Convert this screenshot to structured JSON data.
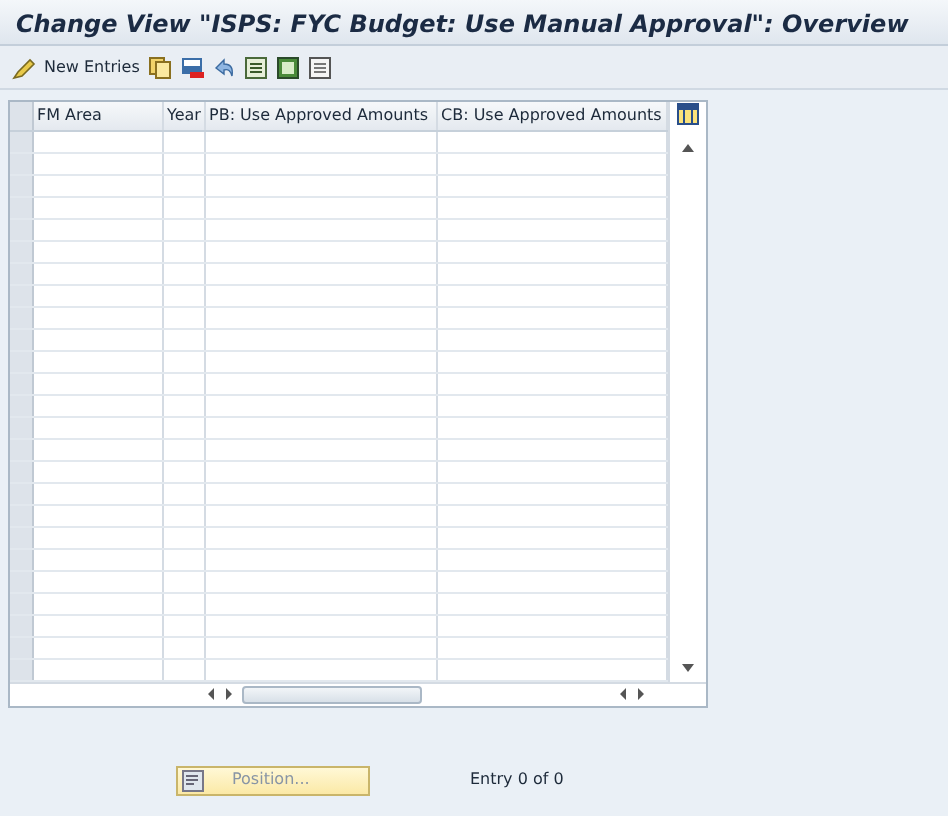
{
  "window": {
    "title": "Change View \"ISPS: FYC Budget: Use Manual Approval\": Overview"
  },
  "toolbar": {
    "new_entries": "New Entries"
  },
  "table": {
    "columns": [
      "FM Area",
      "Year",
      "PB: Use Approved Amounts",
      "CB: Use Approved Amounts"
    ]
  },
  "footer": {
    "position_button": "Position...",
    "entry_count": "Entry 0 of 0"
  }
}
